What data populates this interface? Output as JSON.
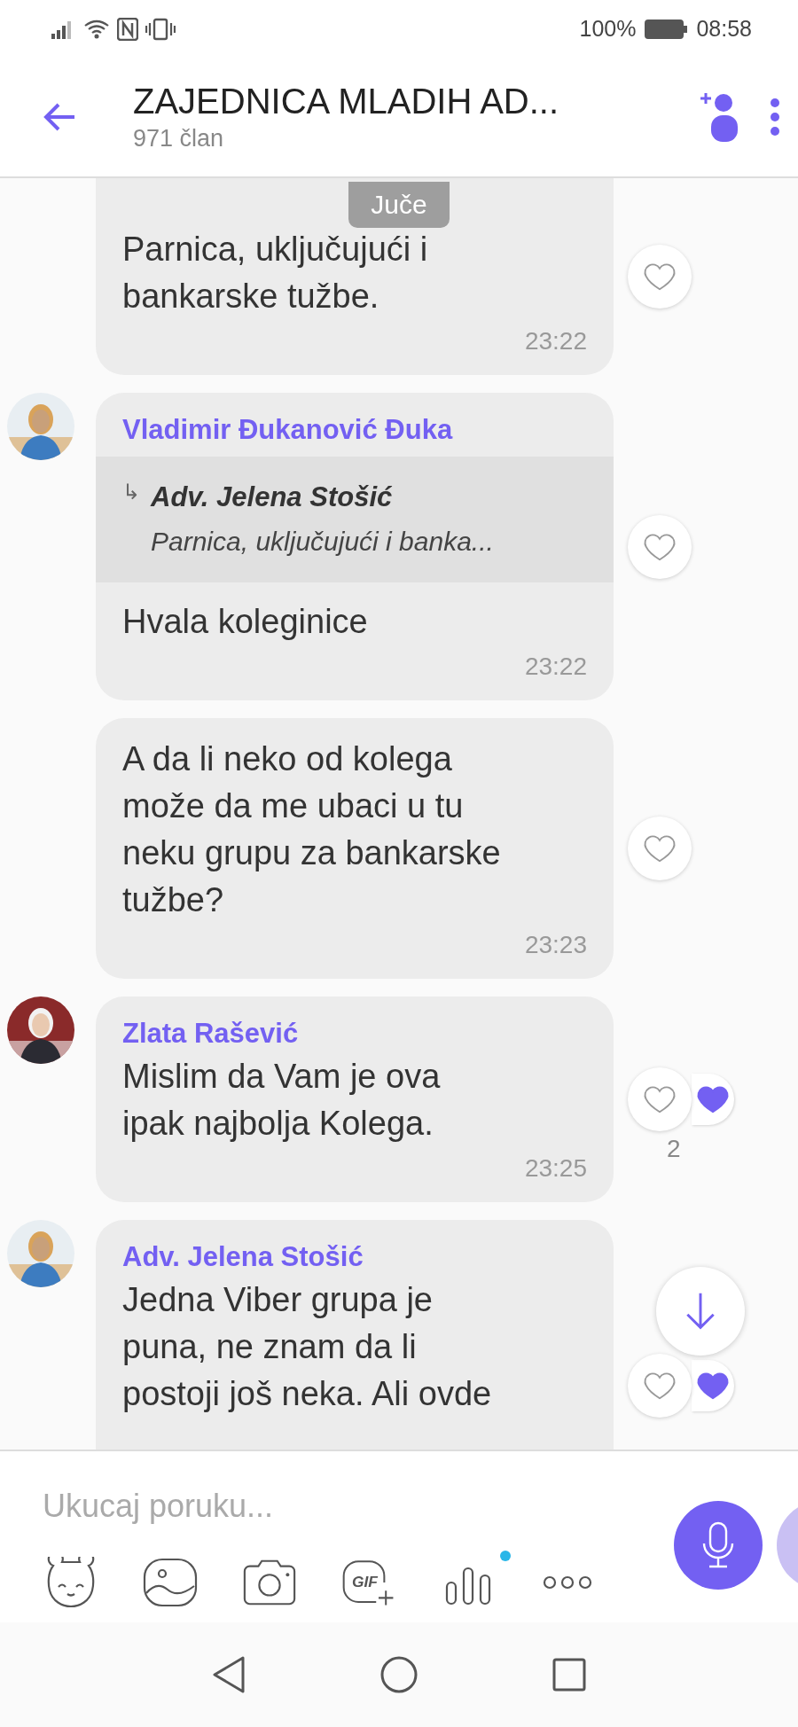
{
  "status_bar": {
    "battery_text": "100%",
    "time": "08:58"
  },
  "header": {
    "title": "ZAJEDNICA MLADIH AD...",
    "subtitle": "971 član"
  },
  "date_chip": "Juče",
  "messages": [
    {
      "text": "Parnica, uključujući i\nbankarske tužbe.",
      "time": "23:22",
      "cut_top": true,
      "reacted": false
    },
    {
      "sender": "Vladimir Đukanović Đuka",
      "reply": {
        "arrow": "↳",
        "name": "Adv. Jelena Stošić",
        "text": "Parnica, uključujući i banka..."
      },
      "text": "Hvala koleginice",
      "time": "23:22",
      "reacted": false
    },
    {
      "text": "A da li neko od kolega\nmože da me ubaci u tu\nneku grupu za bankarske\ntužbe?",
      "time": "23:23",
      "reacted": false
    },
    {
      "sender": "Zlata Rašević",
      "text": "Mislim da Vam je ova\nipak najbolja Kolega.",
      "time": "23:25",
      "reacted": true,
      "reaction_count": "2"
    },
    {
      "sender": "Adv. Jelena Stošić",
      "text": "Jedna Viber grupa je\npuna, ne znam da li\npostoji još neka. Ali ovde",
      "reacted": true
    }
  ],
  "composer": {
    "placeholder": "Ukucaj poruku...",
    "gif_label": "GIF",
    "poll_badge": true
  }
}
